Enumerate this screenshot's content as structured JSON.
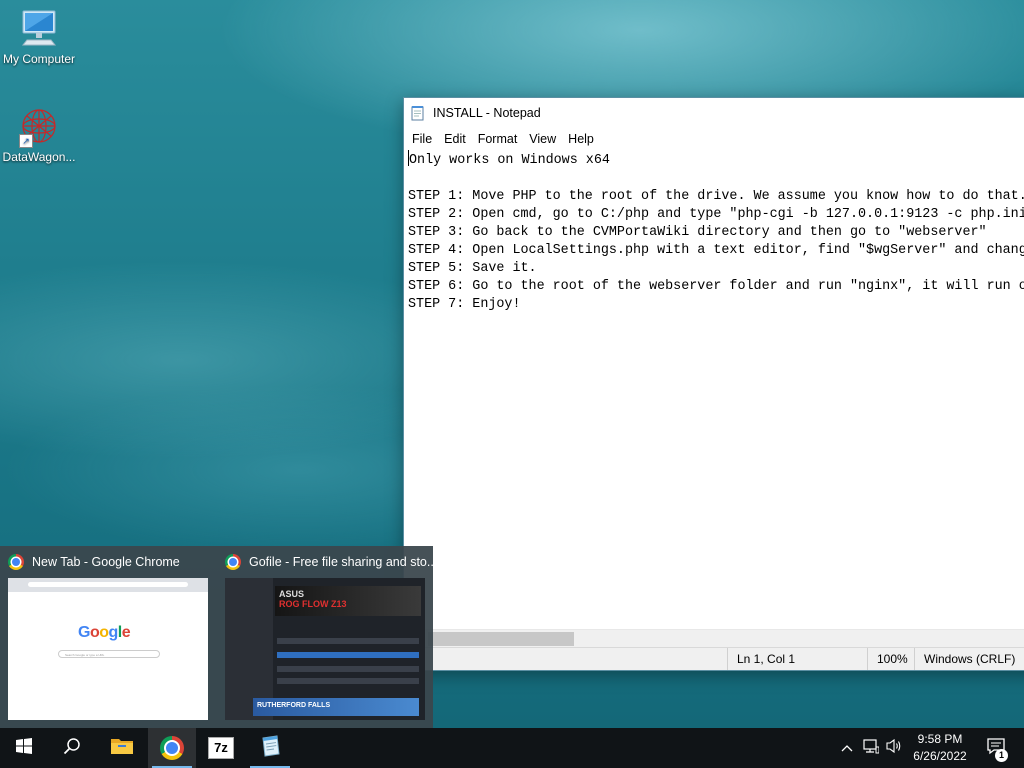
{
  "desktop": {
    "icons": [
      {
        "label": "My Computer",
        "icon": "computer-icon"
      },
      {
        "label": "DataWagon...",
        "icon": "datawagon-icon"
      }
    ]
  },
  "notepad": {
    "title": "INSTALL - Notepad",
    "menu": [
      "File",
      "Edit",
      "Format",
      "View",
      "Help"
    ],
    "content_lines": [
      "Only works on Windows x64",
      "",
      "STEP 1: Move PHP to the root of the drive. We assume you know how to do that.",
      "STEP 2: Open cmd, go to C:/php and type \"php-cgi -b 127.0.0.1:9123 -c php.ini",
      "STEP 3: Go back to the CVMPortaWiki directory and then go to \"webserver\"",
      "STEP 4: Open LocalSettings.php with a text editor, find \"$wgServer\" and chang",
      "STEP 5: Save it.",
      "STEP 6: Go to the root of the webserver folder and run \"nginx\", it will run o",
      "STEP 7: Enjoy!"
    ],
    "status": {
      "position": "Ln 1, Col 1",
      "zoom": "100%",
      "line_ending": "Windows (CRLF)"
    }
  },
  "thumbnails": [
    {
      "title": "New Tab - Google Chrome",
      "preview": {
        "logo": "Google",
        "search_placeholder": "Search Google or type a URL"
      }
    },
    {
      "title": "Gofile - Free file sharing and sto...",
      "preview": {
        "banner": "ROG FLOW Z13",
        "ad": "RUTHERFORD FALLS",
        "brand": "ASUS"
      }
    }
  ],
  "taskbar": {
    "apps": [
      {
        "name": "start",
        "icon": "windows-icon"
      },
      {
        "name": "search",
        "icon": "search-icon"
      },
      {
        "name": "file-explorer",
        "icon": "folder-icon"
      },
      {
        "name": "google-chrome",
        "icon": "chrome-icon"
      },
      {
        "name": "7-zip",
        "icon": "7zip-icon",
        "label": "7z"
      },
      {
        "name": "notepad",
        "icon": "notepad-icon"
      }
    ],
    "clock": {
      "time": "9:58 PM",
      "date": "6/26/2022"
    },
    "notifications": {
      "count": "1"
    }
  },
  "colors": {
    "taskbar": "#101417",
    "accent": "#76b9ed",
    "thumbnail_panel": "#3a464c"
  }
}
